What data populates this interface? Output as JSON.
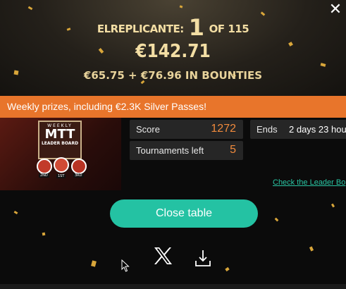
{
  "result": {
    "player_name": "ELREPLICANTE:",
    "rank": "1",
    "of_total": "OF 115",
    "prize": "€142.71",
    "bounties": "€65.75 + €76.96 IN BOUNTIES"
  },
  "banner": {
    "text": "Weekly prizes, including €2.3K Silver Passes!"
  },
  "promo": {
    "image": {
      "top": "WEEKLY",
      "main": "MTT",
      "sub": "LEADER BOARD",
      "places": [
        "2ND",
        "1ST",
        "3RD"
      ]
    },
    "score_label": "Score",
    "score_value": "1272",
    "tournaments_label": "Tournaments left",
    "tournaments_value": "5",
    "ends_label": "Ends",
    "ends_value": "2 days 23 hou",
    "link_text": "Check the Leader Bo"
  },
  "actions": {
    "close_table_label": "Close table",
    "share_icon": "x-logo-icon",
    "download_icon": "download-icon"
  },
  "colors": {
    "accent_teal": "#24c2a3",
    "banner_orange": "#e8752b",
    "gold_text": "#f3dea4",
    "score_orange": "#f08a3c"
  }
}
